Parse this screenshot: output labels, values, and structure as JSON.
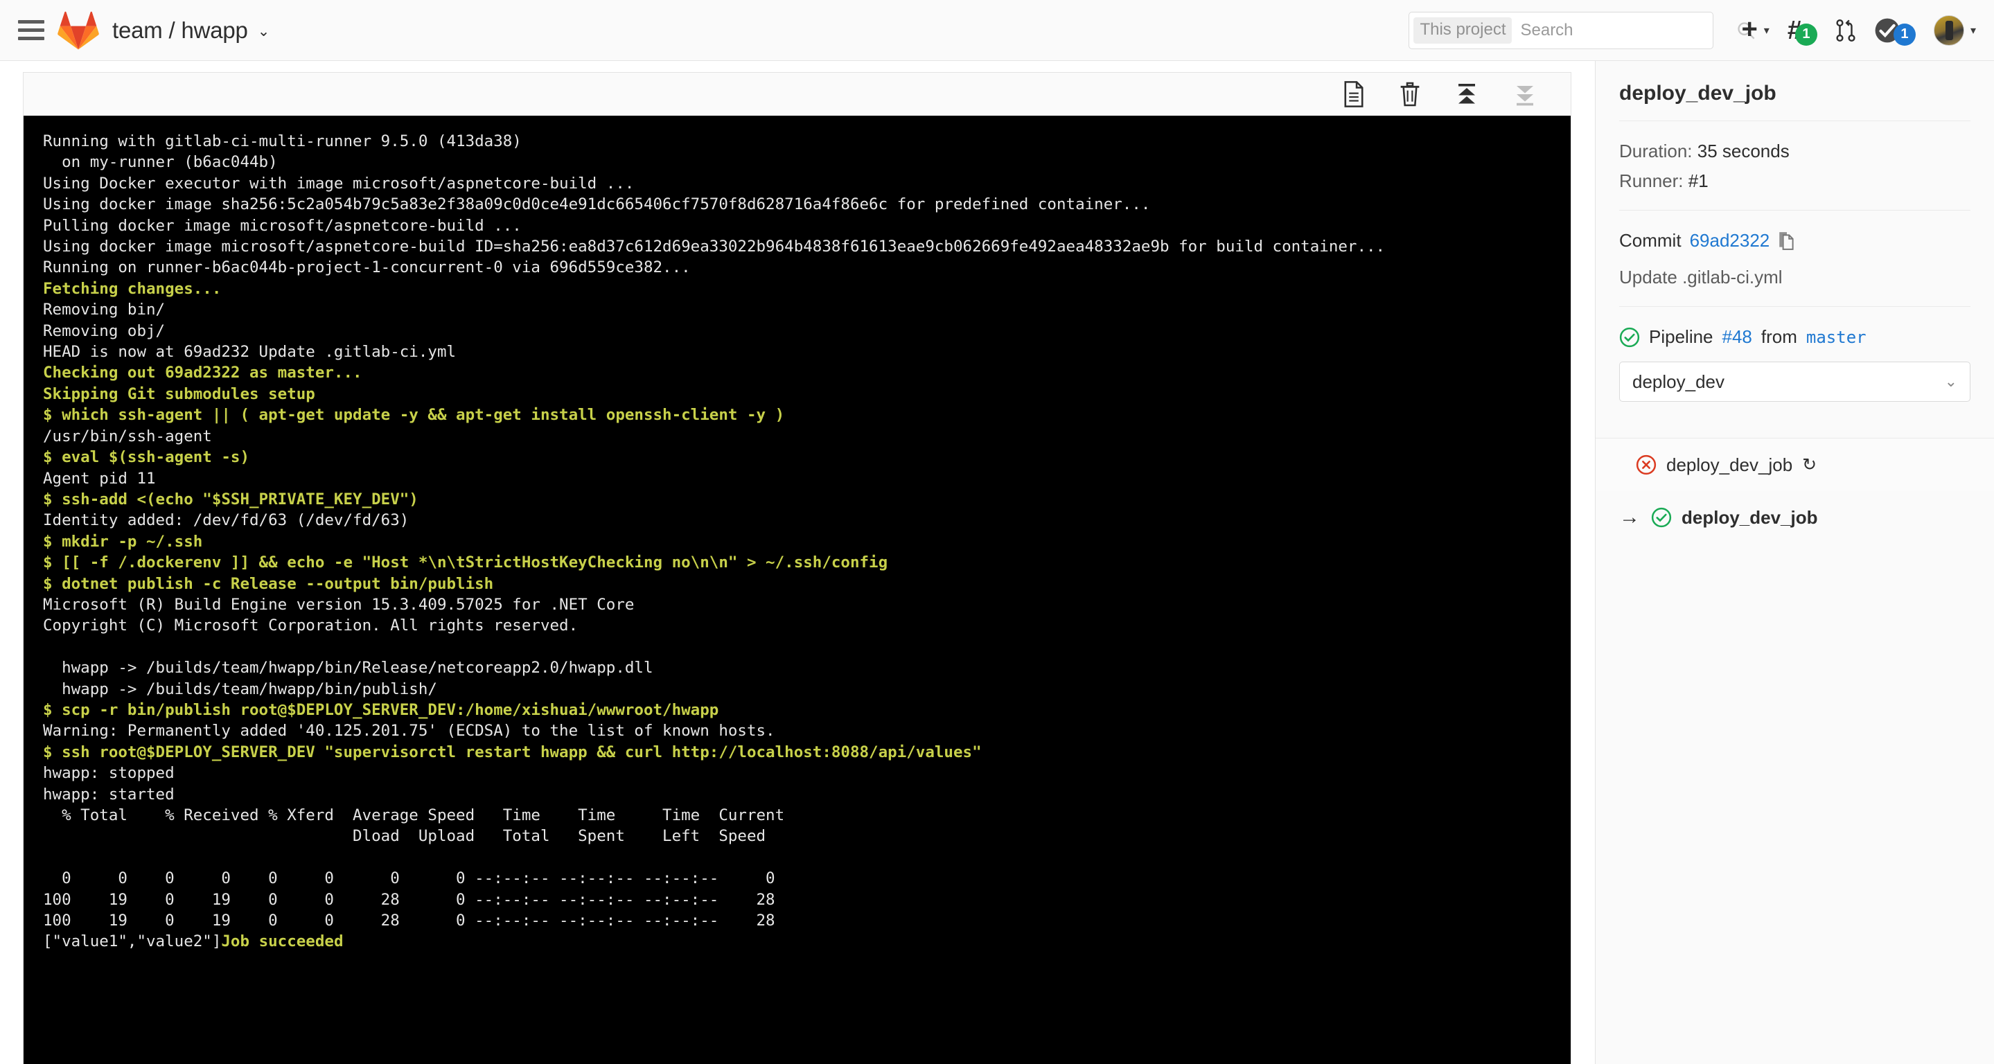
{
  "navbar": {
    "menu_icon": "hamburger-icon",
    "logo_icon": "gitlab-logo",
    "project_path": "team / hwapp",
    "project_caret": "⌄",
    "search": {
      "scope_label": "This project",
      "placeholder": "Search",
      "value": "",
      "icon": "search-icon"
    },
    "new_button": {
      "icon": "plus-icon",
      "caret": "▾"
    },
    "issues": {
      "icon": "issues-hash-icon",
      "count": "1"
    },
    "merge_requests": {
      "icon": "merge-request-icon"
    },
    "todos": {
      "icon": "todo-check-icon",
      "count": "1"
    },
    "user": {
      "icon": "avatar",
      "caret": "▾"
    }
  },
  "log_toolbar": {
    "raw_label": "raw-file-icon",
    "erase_label": "trash-icon",
    "scroll_top_label": "scroll-to-top-icon",
    "scroll_bottom_label": "scroll-to-bottom-icon"
  },
  "terminal": {
    "lines": [
      {
        "t": "Running with gitlab-ci-multi-runner 9.5.0 (413da38)",
        "c": "w"
      },
      {
        "t": "  on my-runner (b6ac044b)",
        "c": "w"
      },
      {
        "t": "Using Docker executor with image microsoft/aspnetcore-build ...",
        "c": "w"
      },
      {
        "t": "Using docker image sha256:5c2a054b79c5a83e2f38a09c0d0ce4e91dc665406cf7570f8d628716a4f86e6c for predefined container...",
        "c": "w"
      },
      {
        "t": "Pulling docker image microsoft/aspnetcore-build ...",
        "c": "w"
      },
      {
        "t": "Using docker image microsoft/aspnetcore-build ID=sha256:ea8d37c612d69ea33022b964b4838f61613eae9cb062669fe492aea48332ae9b for build container...",
        "c": "w"
      },
      {
        "t": "Running on runner-b6ac044b-project-1-concurrent-0 via 696d559ce382...",
        "c": "w"
      },
      {
        "t": "Fetching changes...",
        "c": "g"
      },
      {
        "t": "Removing bin/",
        "c": "w"
      },
      {
        "t": "Removing obj/",
        "c": "w"
      },
      {
        "t": "HEAD is now at 69ad232 Update .gitlab-ci.yml",
        "c": "w"
      },
      {
        "t": "Checking out 69ad2322 as master...",
        "c": "g"
      },
      {
        "t": "Skipping Git submodules setup",
        "c": "g"
      },
      {
        "t": "$ which ssh-agent || ( apt-get update -y && apt-get install openssh-client -y )",
        "c": "g"
      },
      {
        "t": "/usr/bin/ssh-agent",
        "c": "w"
      },
      {
        "t": "$ eval $(ssh-agent -s)",
        "c": "g"
      },
      {
        "t": "Agent pid 11",
        "c": "w"
      },
      {
        "t": "$ ssh-add <(echo \"$SSH_PRIVATE_KEY_DEV\")",
        "c": "g"
      },
      {
        "t": "Identity added: /dev/fd/63 (/dev/fd/63)",
        "c": "w"
      },
      {
        "t": "$ mkdir -p ~/.ssh",
        "c": "g"
      },
      {
        "t": "$ [[ -f /.dockerenv ]] && echo -e \"Host *\\n\\tStrictHostKeyChecking no\\n\\n\" > ~/.ssh/config",
        "c": "g"
      },
      {
        "t": "$ dotnet publish -c Release --output bin/publish",
        "c": "g"
      },
      {
        "t": "Microsoft (R) Build Engine version 15.3.409.57025 for .NET Core",
        "c": "w"
      },
      {
        "t": "Copyright (C) Microsoft Corporation. All rights reserved.",
        "c": "w"
      },
      {
        "t": "",
        "c": "w"
      },
      {
        "t": "  hwapp -> /builds/team/hwapp/bin/Release/netcoreapp2.0/hwapp.dll",
        "c": "w"
      },
      {
        "t": "  hwapp -> /builds/team/hwapp/bin/publish/",
        "c": "w"
      },
      {
        "t": "$ scp -r bin/publish root@$DEPLOY_SERVER_DEV:/home/xishuai/wwwroot/hwapp",
        "c": "g"
      },
      {
        "t": "Warning: Permanently added '40.125.201.75' (ECDSA) to the list of known hosts.",
        "c": "w"
      },
      {
        "t": "$ ssh root@$DEPLOY_SERVER_DEV \"supervisorctl restart hwapp && curl http://localhost:8088/api/values\"",
        "c": "g"
      },
      {
        "t": "hwapp: stopped",
        "c": "w"
      },
      {
        "t": "hwapp: started",
        "c": "w"
      },
      {
        "t": "  % Total    % Received % Xferd  Average Speed   Time    Time     Time  Current",
        "c": "w"
      },
      {
        "t": "                                 Dload  Upload   Total   Spent    Left  Speed",
        "c": "w"
      },
      {
        "t": "",
        "c": "w"
      },
      {
        "t": "  0     0    0     0    0     0      0      0 --:--:-- --:--:-- --:--:--     0",
        "c": "w"
      },
      {
        "t": "100    19    0    19    0     0     28      0 --:--:-- --:--:-- --:--:--    28",
        "c": "w"
      },
      {
        "t": "100    19    0    19    0     0     28      0 --:--:-- --:--:-- --:--:--    28",
        "c": "w"
      }
    ],
    "last_line": {
      "output": "[\"value1\",\"value2\"]",
      "status": "Job succeeded"
    }
  },
  "sidebar": {
    "job_title": "deploy_dev_job",
    "duration_label": "Duration:",
    "duration_value": "35 seconds",
    "runner_label": "Runner:",
    "runner_value": "#1",
    "commit_label": "Commit",
    "commit_sha": "69ad2322",
    "copy_icon": "copy-icon",
    "commit_message": "Update .gitlab-ci.yml",
    "pipeline_status_icon": "status-success-icon",
    "pipeline_prefix": "Pipeline",
    "pipeline_number": "#48",
    "pipeline_from": "from",
    "pipeline_ref": "master",
    "stage_select_value": "deploy_dev",
    "stage_select_caret": "⌄",
    "jobs": [
      {
        "name": "deploy_dev_job",
        "status": "failed",
        "status_icon": "status-failed-icon",
        "retry_icon": "retry-icon",
        "current": false
      },
      {
        "name": "deploy_dev_job",
        "status": "success",
        "status_icon": "status-success-icon",
        "arrow_icon": "current-job-arrow-icon",
        "current": true
      }
    ]
  },
  "colors": {
    "terminal_bg": "#000000",
    "terminal_text": "#e8e8e8",
    "terminal_green": "#c8d14a",
    "link_blue": "#1f78d1",
    "success_green": "#1aaa55",
    "failed_red": "#db3b21",
    "gitlab_orange": "#e24329"
  }
}
